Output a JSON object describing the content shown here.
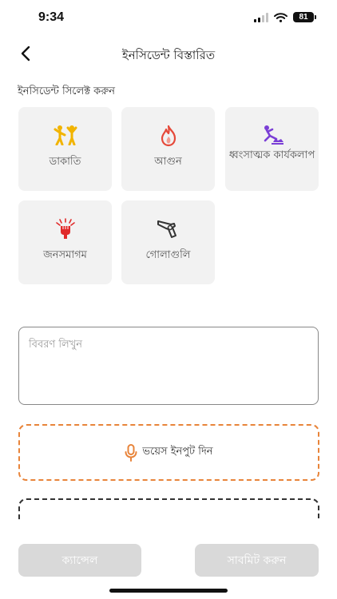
{
  "status": {
    "time": "9:34",
    "battery": "81"
  },
  "header": {
    "title": "ইনসিডেন্ট বিস্তারিত"
  },
  "section": {
    "label": "ইনসিডেন্ট সিলেক্ট করুন"
  },
  "incidents": [
    {
      "label": "ডাকাতি",
      "icon": "robbery-icon",
      "color": "#f2b400"
    },
    {
      "label": "আগুন",
      "icon": "fire-icon",
      "color": "#e5493a"
    },
    {
      "label": "ধ্বংসাত্মক কার্যকলাপ",
      "icon": "destruction-icon",
      "color": "#7b3fd6"
    },
    {
      "label": "জনসমাগম",
      "icon": "crowd-icon",
      "color": "#e02a2a"
    },
    {
      "label": "গোলাগুলি",
      "icon": "gun-icon",
      "color": "#333333"
    }
  ],
  "description": {
    "placeholder": "বিবরণ লিখুন"
  },
  "voice": {
    "label": "ভয়েস ইনপুট দিন",
    "color": "#e8843a"
  },
  "actions": {
    "cancel": "ক্যান্সেল",
    "submit": "সাবমিট করুন"
  }
}
